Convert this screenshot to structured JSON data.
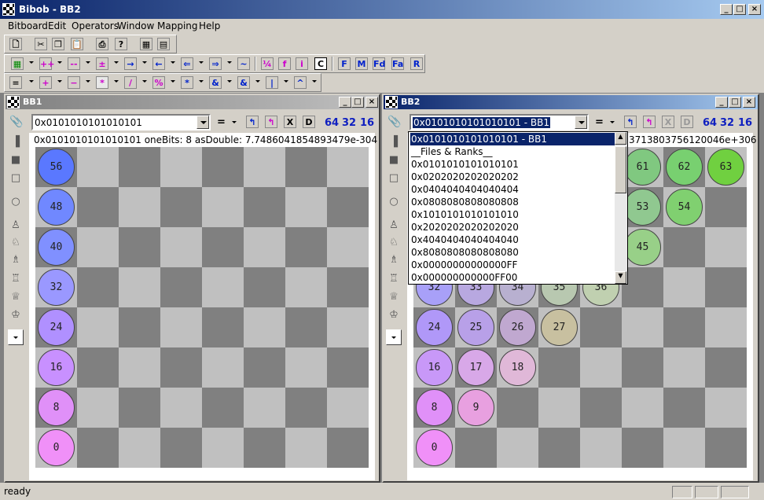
{
  "app": {
    "title": "Bibob - BB2"
  },
  "menu": [
    "Bitboard",
    "Edit",
    "Operators",
    "Window",
    "Mapping",
    "Help"
  ],
  "bb1": {
    "title": "BB1",
    "combo_value": "0x0101010101010101",
    "op": "=",
    "info": "0x0101010101010101  oneBits:  8 asDouble: 7.7486041854893479e-304",
    "sizes": [
      "64",
      "32",
      "16"
    ]
  },
  "bb2": {
    "title": "BB2",
    "combo_value": "0x0101010101010101 - BB1",
    "op": "=",
    "info": "3713803756120046e+306",
    "sizes": [
      "64",
      "32",
      "16"
    ]
  },
  "dropdown": [
    "0x0101010101010101 - BB1",
    "__Files & Ranks__",
    "0x0101010101010101",
    "0x0202020202020202",
    "0x0404040404040404",
    "0x0808080808080808",
    "0x1010101010101010",
    "0x2020202020202020",
    "0x4040404040404040",
    "0x8080808080808080",
    "0x00000000000000FF",
    "0x000000000000FF00"
  ],
  "bb1_balls": [
    {
      "n": "56",
      "c": "#5a78ff"
    },
    {
      "n": "48",
      "c": "#7088ff"
    },
    {
      "n": "40",
      "c": "#8090ff"
    },
    {
      "n": "32",
      "c": "#9a98ff"
    },
    {
      "n": "24",
      "c": "#b090ff"
    },
    {
      "n": "16",
      "c": "#c890ff"
    },
    {
      "n": "8",
      "c": "#e090f8"
    },
    {
      "n": "0",
      "c": "#f090f8"
    }
  ],
  "bb2_balls": [
    {
      "n": "61",
      "c": "#80c880"
    },
    {
      "n": "62",
      "c": "#78d070"
    },
    {
      "n": "63",
      "c": "#70d040"
    },
    {
      "n": "53",
      "c": "#90c890"
    },
    {
      "n": "54",
      "c": "#80d070"
    },
    {
      "n": "45",
      "c": "#98d088"
    },
    {
      "n": "32",
      "c": "#a8a0f8"
    },
    {
      "n": "33",
      "c": "#b8a8e0"
    },
    {
      "n": "34",
      "c": "#b8b0d0"
    },
    {
      "n": "35",
      "c": "#b8c8b0"
    },
    {
      "n": "36",
      "c": "#c0d0b0"
    },
    {
      "n": "24",
      "c": "#b098f8"
    },
    {
      "n": "25",
      "c": "#b8a0e8"
    },
    {
      "n": "26",
      "c": "#c0a8d0"
    },
    {
      "n": "27",
      "c": "#c8c0a0"
    },
    {
      "n": "16",
      "c": "#c898f8"
    },
    {
      "n": "17",
      "c": "#d8a8e8"
    },
    {
      "n": "18",
      "c": "#e0b8d8"
    },
    {
      "n": "8",
      "c": "#e090f8"
    },
    {
      "n": "9",
      "c": "#e8a0e0"
    },
    {
      "n": "0",
      "c": "#f090f8"
    }
  ],
  "status": {
    "text": "ready"
  }
}
